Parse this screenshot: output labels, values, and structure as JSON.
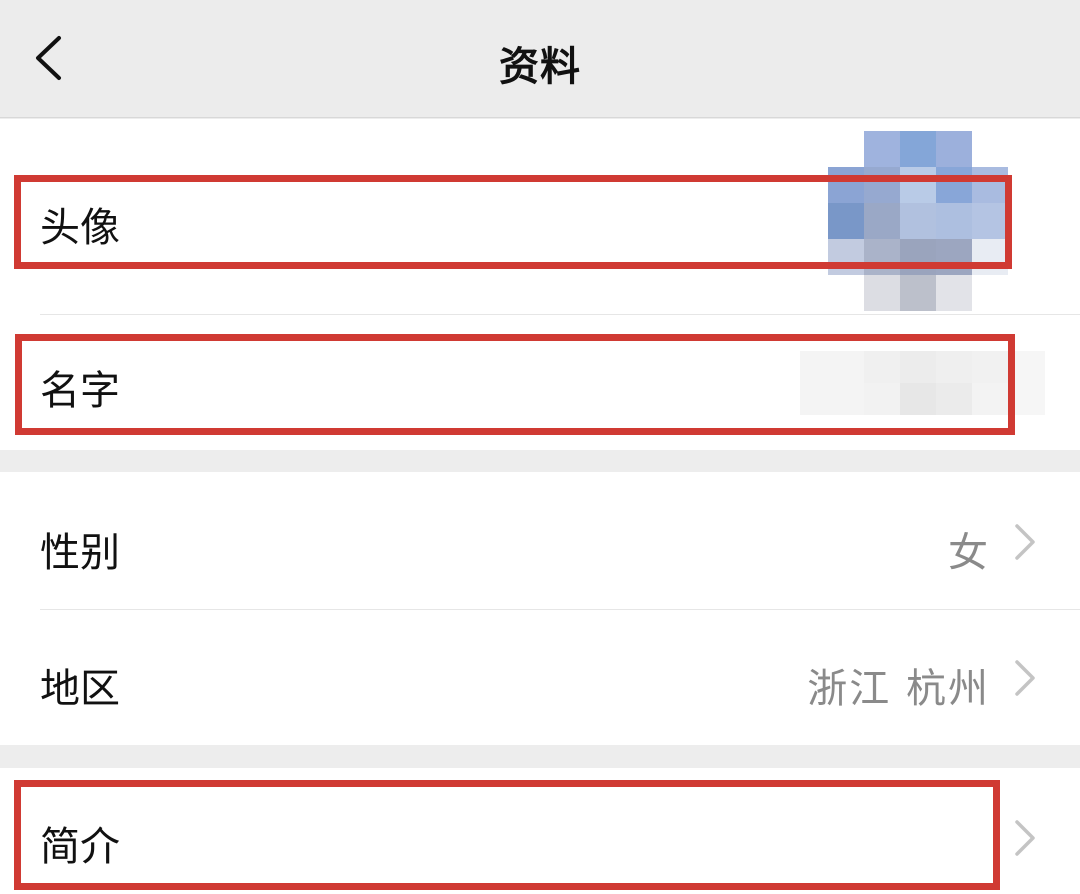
{
  "nav": {
    "title": "资料",
    "back_icon": "chevron-left-icon"
  },
  "rows": {
    "avatar": {
      "label": "头像"
    },
    "name": {
      "label": "名字"
    },
    "gender": {
      "label": "性别",
      "value": "女"
    },
    "region": {
      "label": "地区",
      "value": "浙江 杭州"
    },
    "bio": {
      "label": "简介"
    }
  },
  "colors": {
    "highlight_box": "#d03a33",
    "page_background": "#ededed",
    "card_background": "#ffffff",
    "value_text": "#8a8a8a",
    "chevron": "#c4c4c4"
  }
}
